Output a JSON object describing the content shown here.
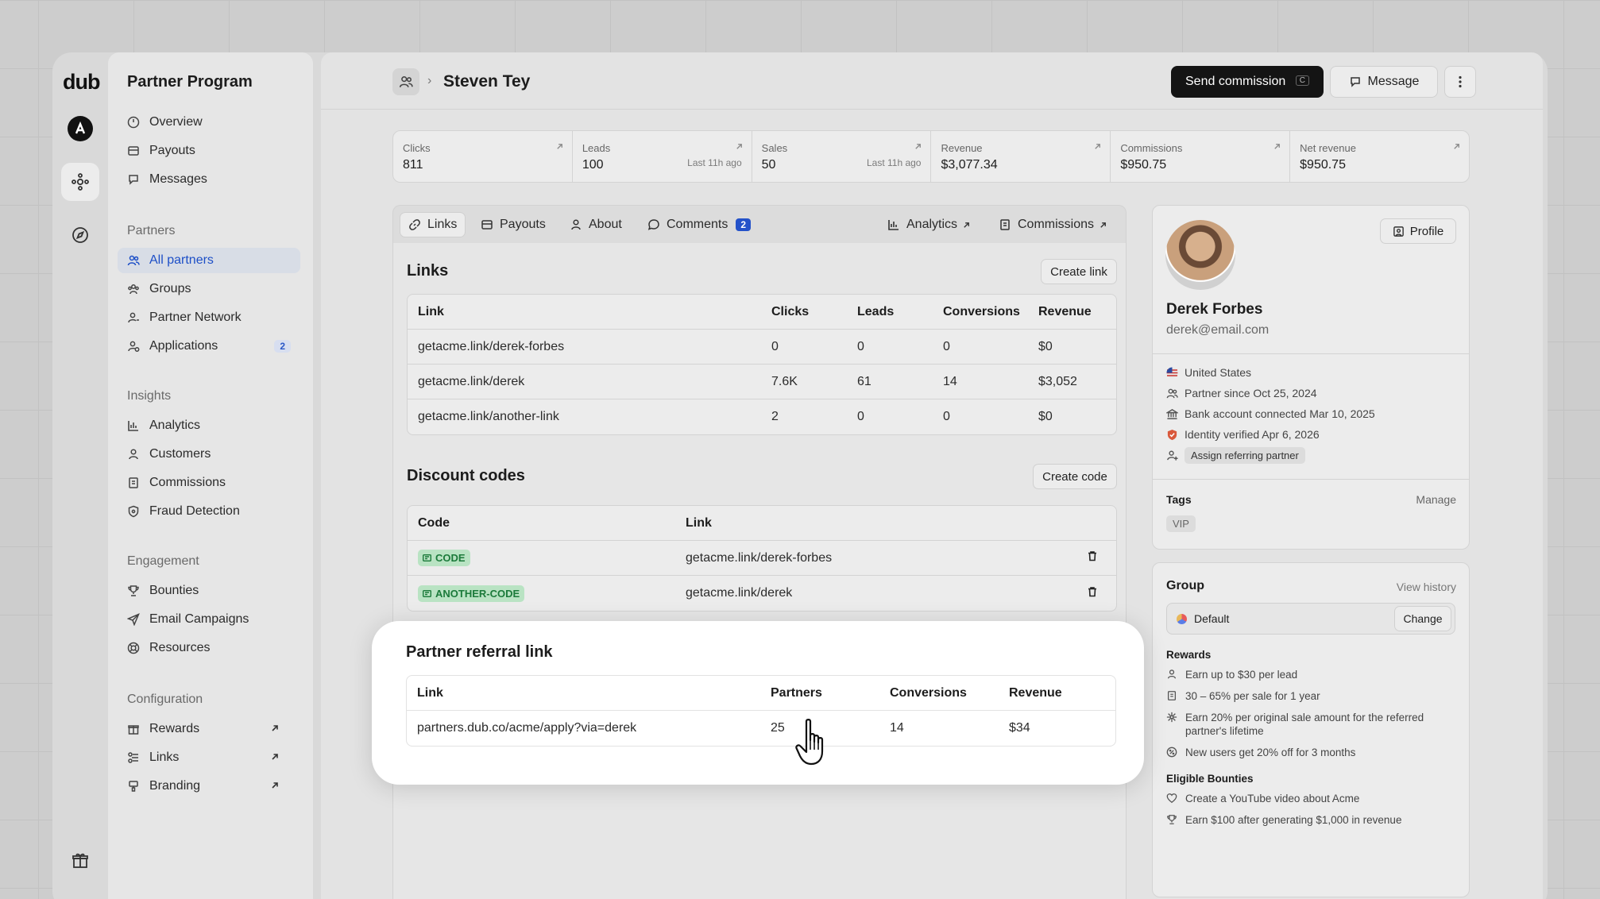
{
  "brand": {
    "logo": "dub"
  },
  "sidebar": {
    "title": "Partner Program",
    "top": [
      {
        "label": "Overview"
      },
      {
        "label": "Payouts"
      },
      {
        "label": "Messages"
      }
    ],
    "sections": [
      {
        "title": "Partners",
        "items": [
          {
            "label": "All partners"
          },
          {
            "label": "Groups"
          },
          {
            "label": "Partner Network"
          },
          {
            "label": "Applications",
            "badge": "2"
          }
        ]
      },
      {
        "title": "Insights",
        "items": [
          {
            "label": "Analytics"
          },
          {
            "label": "Customers"
          },
          {
            "label": "Commissions"
          },
          {
            "label": "Fraud Detection"
          }
        ]
      },
      {
        "title": "Engagement",
        "items": [
          {
            "label": "Bounties"
          },
          {
            "label": "Email Campaigns"
          },
          {
            "label": "Resources"
          }
        ]
      },
      {
        "title": "Configuration",
        "items": [
          {
            "label": "Rewards"
          },
          {
            "label": "Links"
          },
          {
            "label": "Branding"
          }
        ]
      }
    ]
  },
  "header": {
    "title": "Steven Tey",
    "send_commission": "Send commission",
    "send_shortcut": "C",
    "message": "Message"
  },
  "stats": [
    {
      "label": "Clicks",
      "value": "811",
      "sub": ""
    },
    {
      "label": "Leads",
      "value": "100",
      "sub": "Last 11h ago"
    },
    {
      "label": "Sales",
      "value": "50",
      "sub": "Last 11h ago"
    },
    {
      "label": "Revenue",
      "value": "$3,077.34",
      "sub": ""
    },
    {
      "label": "Commissions",
      "value": "$950.75",
      "sub": ""
    },
    {
      "label": "Net revenue",
      "value": "$950.75",
      "sub": ""
    }
  ],
  "tabs": {
    "links": "Links",
    "payouts": "Payouts",
    "about": "About",
    "comments": "Comments",
    "comments_count": "2",
    "analytics": "Analytics",
    "commissions": "Commissions"
  },
  "links": {
    "title": "Links",
    "create": "Create link",
    "columns": [
      "Link",
      "Clicks",
      "Leads",
      "Conversions",
      "Revenue"
    ],
    "rows": [
      [
        "getacme.link/derek-forbes",
        "0",
        "0",
        "0",
        "$0"
      ],
      [
        "getacme.link/derek",
        "7.6K",
        "61",
        "14",
        "$3,052"
      ],
      [
        "getacme.link/another-link",
        "2",
        "0",
        "0",
        "$0"
      ]
    ]
  },
  "discounts": {
    "title": "Discount codes",
    "create": "Create code",
    "columns": [
      "Code",
      "Link"
    ],
    "rows": [
      [
        "CODE",
        "getacme.link/derek-forbes"
      ],
      [
        "ANOTHER-CODE",
        "getacme.link/derek"
      ]
    ]
  },
  "referral": {
    "title": "Partner referral link",
    "columns": [
      "Link",
      "Partners",
      "Conversions",
      "Revenue"
    ],
    "rows": [
      [
        "partners.dub.co/acme/apply?via=derek",
        "25",
        "14",
        "$34"
      ]
    ]
  },
  "profile": {
    "button": "Profile",
    "name": "Derek Forbes",
    "email": "derek@email.com",
    "country": "United States",
    "since": "Partner since Oct 25, 2024",
    "bank": "Bank account connected Mar 10, 2025",
    "identity": "Identity verified Apr 6, 2026",
    "assign": "Assign referring partner",
    "tags_label": "Tags",
    "manage": "Manage",
    "tag": "VIP"
  },
  "group": {
    "title": "Group",
    "history": "View history",
    "name": "Default",
    "change": "Change",
    "rewards_label": "Rewards",
    "rewards": [
      "Earn up to $30 per lead",
      "30 – 65% per sale for 1 year",
      "Earn 20% per original sale amount for the referred partner's lifetime",
      "New users get 20% off for 3 months"
    ],
    "bounties_label": "Eligible Bounties",
    "bounties": [
      "Create a YouTube video about Acme",
      "Earn $100 after generating $1,000 in revenue"
    ]
  },
  "colors": {
    "accent": "#2452c9",
    "dark_button": "#141414",
    "code_tag": "#b9e3c3"
  }
}
